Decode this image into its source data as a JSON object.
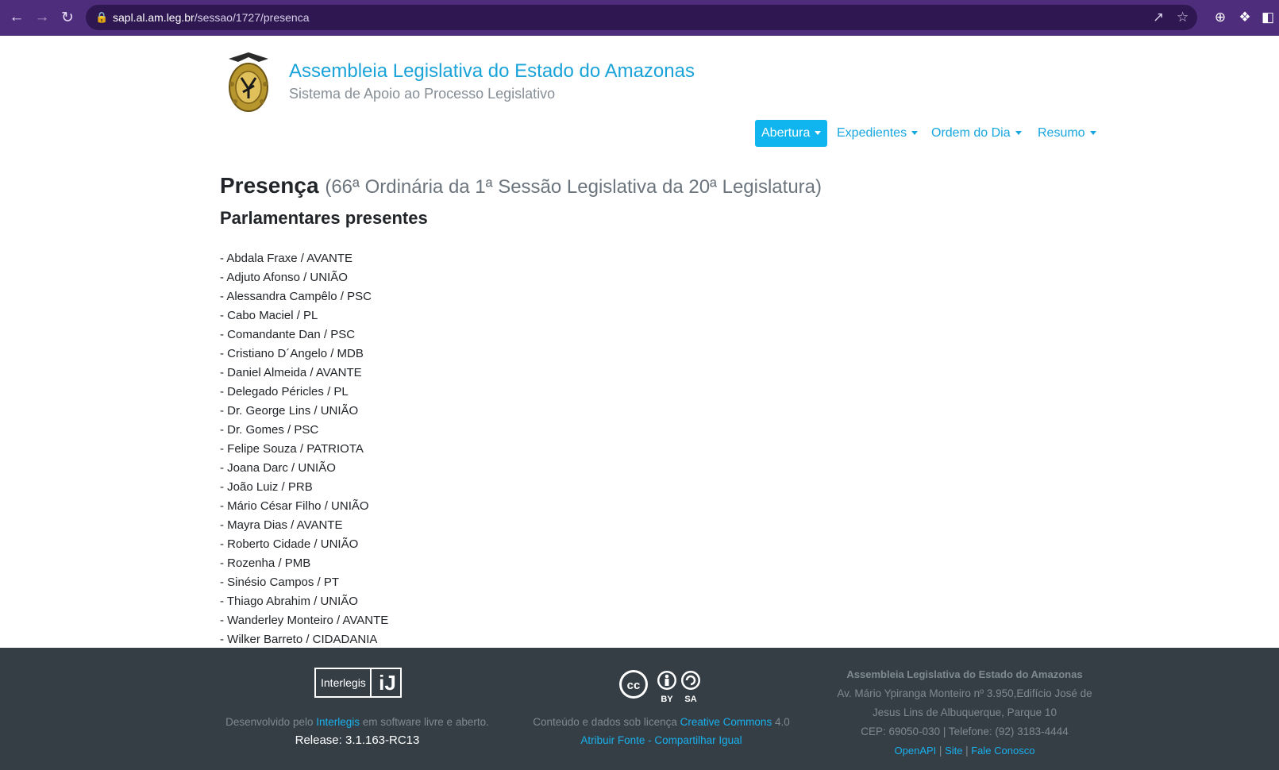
{
  "browser": {
    "url_host": "sapl.al.am.leg.br",
    "url_path": "/sessao/1727/presenca"
  },
  "header": {
    "title": "Assembleia Legislativa do Estado do Amazonas",
    "subtitle": "Sistema de Apoio ao Processo Legislativo"
  },
  "menu": {
    "items": [
      {
        "label": "Abertura",
        "active": true
      },
      {
        "label": "Expedientes"
      },
      {
        "label": "Ordem do Dia"
      },
      {
        "label": "Resumo"
      }
    ]
  },
  "page": {
    "heading": "Presença",
    "heading_sub": "(66ª Ordinária da 1ª Sessão Legislativa da 20ª Legislatura)",
    "section": "Parlamentares presentes",
    "members": [
      "- Abdala Fraxe / AVANTE",
      "- Adjuto Afonso / UNIÃO",
      "- Alessandra Campêlo / PSC",
      "- Cabo Maciel / PL",
      "- Comandante Dan / PSC",
      "- Cristiano D´Angelo / MDB",
      "- Daniel Almeida / AVANTE",
      "- Delegado Péricles / PL",
      "- Dr. George Lins / UNIÃO",
      "- Dr. Gomes / PSC",
      "- Felipe Souza / PATRIOTA",
      "- Joana Darc / UNIÃO",
      "- João Luiz / PRB",
      "- Mário César Filho / UNIÃO",
      "- Mayra Dias / AVANTE",
      "- Roberto Cidade / UNIÃO",
      "- Rozenha / PMB",
      "- Sinésio Campos / PT",
      "- Thiago Abrahim / UNIÃO",
      "- Wanderley Monteiro / AVANTE",
      "- Wilker Barreto / CIDADANIA"
    ]
  },
  "footer": {
    "interlegis_logo_text": "Interlegis",
    "developed_prefix": "Desenvolvido pelo",
    "developed_link": "Interlegis",
    "developed_suffix": "em software livre e aberto.",
    "release": "Release: 3.1.163-RC13",
    "cc_by": "BY",
    "cc_sa": "SA",
    "license_prefix": "Conteúdo e dados sob licença",
    "license_link": "Creative Commons",
    "license_version": "4.0",
    "license_terms": "Atribuir Fonte - Compartilhar Igual",
    "org_name": "Assembleia Legislativa do Estado do Amazonas",
    "address_line1": "Av. Mário Ypiranga Monteiro nº 3.950,Edifício José de",
    "address_line2": "Jesus Lins de Albuquerque, Parque 10",
    "contact": "CEP: 69050-030 | Telefone: (92) 3183-4444",
    "links": [
      "OpenAPI",
      "Site",
      "Fale Conosco"
    ]
  },
  "colors": {
    "browser_frame": "#4e2d7d",
    "link": "#1aa3d9",
    "menu_active_bg": "#10b4ef",
    "footer_bg": "#343e44"
  }
}
